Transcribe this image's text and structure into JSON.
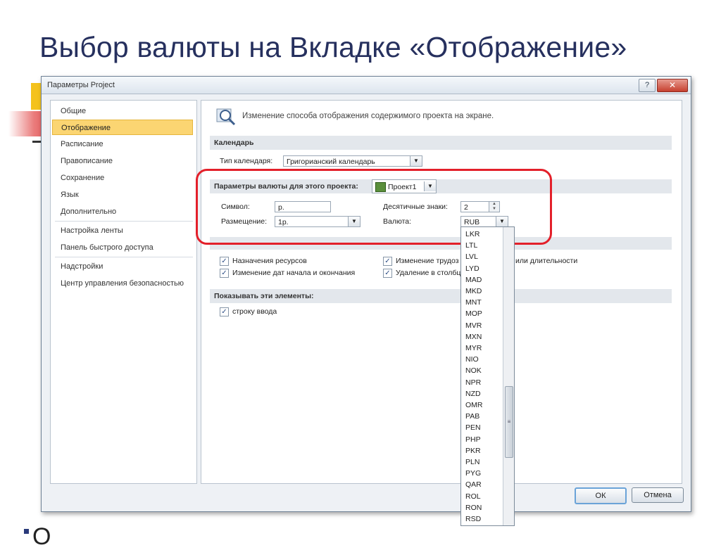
{
  "slide": {
    "title": "Выбор валюты на Вкладке «Отображение»",
    "bottom_partial": "О"
  },
  "dialog": {
    "title": "Параметры Project",
    "help_label": "?",
    "close_label": "✕"
  },
  "nav": {
    "items": [
      {
        "label": "Общие"
      },
      {
        "label": "Отображение"
      },
      {
        "label": "Расписание"
      },
      {
        "label": "Правописание"
      },
      {
        "label": "Сохранение"
      },
      {
        "label": "Язык"
      },
      {
        "label": "Дополнительно"
      },
      {
        "label": "Настройка ленты"
      },
      {
        "label": "Панель быстрого доступа"
      },
      {
        "label": "Надстройки"
      },
      {
        "label": "Центр управления безопасностью"
      }
    ],
    "active_index": 1
  },
  "panel": {
    "header_text": "Изменение способа отображения содержимого проекта на экране.",
    "calendar": {
      "section": "Календарь",
      "type_label": "Тип календаря:",
      "type_value": "Григорианский календарь"
    },
    "currency": {
      "section": "Параметры валюты для этого проекта:",
      "project_value": "Проект1",
      "symbol_label": "Символ:",
      "symbol_value": "р.",
      "placement_label": "Размещение:",
      "placement_value": "1р.",
      "decimals_label": "Десятичные знаки:",
      "decimals_value": "2",
      "currency_label": "Валюта:",
      "currency_value": "RUB"
    },
    "indicators": {
      "items": [
        {
          "label": "Назначения ресурсов"
        },
        {
          "label": "Изменение дат начала и окончания"
        },
        {
          "label": "Изменение трудоз"
        },
        {
          "label": "Удаление в столбц"
        }
      ],
      "trailing_text": "или длительности"
    },
    "show": {
      "section": "Показывать эти элементы:",
      "entry_bar_label": "строку ввода"
    }
  },
  "currency_list": [
    "LKR",
    "LTL",
    "LVL",
    "LYD",
    "MAD",
    "MKD",
    "MNT",
    "MOP",
    "MVR",
    "MXN",
    "MYR",
    "NIO",
    "NOK",
    "NPR",
    "NZD",
    "OMR",
    "PAB",
    "PEN",
    "PHP",
    "PKR",
    "PLN",
    "PYG",
    "QAR",
    "ROL",
    "RON",
    "RSD"
  ],
  "buttons": {
    "ok": "ОК",
    "cancel": "Отмена"
  },
  "colors": {
    "title": "#26305e",
    "highlight_ring": "#e3202a",
    "active_nav": "#fbd572"
  }
}
